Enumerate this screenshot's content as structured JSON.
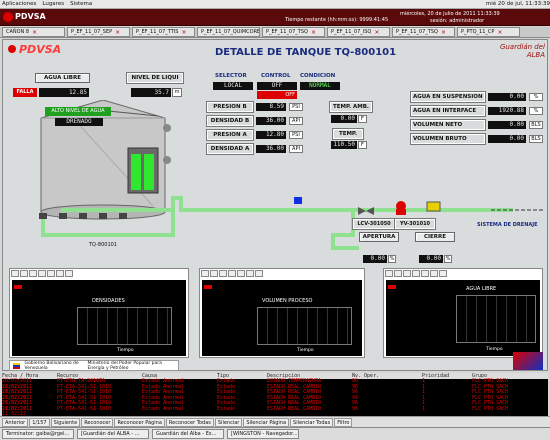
{
  "os_bar": {
    "apps": "Aplicaciones",
    "places": "Lugares",
    "system": "Sistema",
    "clock": "mié 20 de jul, 11:33:39"
  },
  "app_header": {
    "brand": "PDVSA",
    "info1": "Tiempo restante (hh:mm:ss): 9999:41:45",
    "info2": "miércoles, 20 de julio de 2011 11:33:39",
    "info3": "sesión: administrador"
  },
  "tabs": [
    {
      "label": "CAÑON 8"
    },
    {
      "label": "P_EF_11_07_SEP"
    },
    {
      "label": "P_EF_11_07_TTIS"
    },
    {
      "label": "P_EF_11_07_QUIMCORE"
    },
    {
      "label": "P_EF_11_07_TSQ"
    },
    {
      "label": "P_EF_11_07_ISQ"
    },
    {
      "label": "P_EF_11_07_TSQ"
    },
    {
      "label": "P_PTQ_11_CP"
    }
  ],
  "page": {
    "brand": "PDVSA",
    "title": "DETALLE DE TANQUE TQ-800101",
    "right_logo": "Guardián del ALBA"
  },
  "controls": {
    "agua_libre_label": "AGUA LIBRE",
    "agua_libre_status": "FALLA",
    "agua_libre_val": "12.85",
    "nivel_label": "NIVEL DE LIQUI",
    "nivel_val": "35.7",
    "nivel_unit": "m",
    "selector_label": "SELECTOR",
    "selector_val": "LOCAL",
    "control_label": "CONTROL",
    "control_val": "OFF",
    "condicion_label": "CONDICION",
    "condicion_val": "NORMAL",
    "off2": "OFF"
  },
  "tank": {
    "alarm_label": "ALTO NIVEL DE AGUA",
    "alarm_state": "DRENADO",
    "name": "TQ-800101"
  },
  "readings": [
    {
      "label": "PRESION B",
      "value": "8.59",
      "unit": "PSI"
    },
    {
      "label": "DENSIDAD B",
      "value": "36.00",
      "unit": "API"
    },
    {
      "label": "PRESION A",
      "value": "12.80",
      "unit": "PSI"
    },
    {
      "label": "DENSIDAD A",
      "value": "36.00",
      "unit": "API"
    }
  ],
  "temp": {
    "amb_label": "TEMP. AMB.",
    "amb_value": "0.00",
    "amb_unit": "F",
    "temp_label": "TEMP.",
    "temp_value": "110.50",
    "temp_unit": "F"
  },
  "volumes": [
    {
      "label": "AGUA EN SUSPENSION",
      "value": "0.00",
      "unit": "%"
    },
    {
      "label": "AGUA EN INTERFACE",
      "value": "1920.88",
      "unit": "%"
    },
    {
      "label": "VOLUMEN NETO",
      "value": "0.00",
      "unit": "BLS"
    },
    {
      "label": "VOLUMEN BRUTO",
      "value": "0.00",
      "unit": "BLS"
    }
  ],
  "valves": {
    "lcv": "LCV-301050",
    "yv": "YV-301010",
    "apertura": "APERTURA",
    "cierre": "CIERRE",
    "pct1": "0.00",
    "pct2": "0.00",
    "pct_unit": "%",
    "sistema": "SISTEMA DE DRENAJE"
  },
  "trends": [
    {
      "title": "DENSIDADES",
      "xlabel": "Tiempo"
    },
    {
      "title": "VOLUMEN PROCESO",
      "xlabel": "Tiempo"
    },
    {
      "title": "AGUA LIBRE",
      "xlabel": "Tiempo"
    }
  ],
  "footer_logo": {
    "left": "Gobierno Bolivariano de Venezuela",
    "right": "Ministerio del Poder Popular para Energía y Petróleo"
  },
  "alarms": {
    "headers": [
      "Fecha / Hora",
      "Recurso",
      "Causa",
      "Tipo",
      "Descripción",
      "Nv. Oper.",
      "Prioridad",
      "Grupo"
    ],
    "rows": [
      [
        "20/07/2011 11:32:27",
        "PT-ETA-TA-2010TA",
        "Estado Anormal",
        "Estado",
        "ESTADO TEMPERATURA",
        "96",
        "1",
        "FLC PTQ SACH"
      ],
      [
        "20/07/2011 11:32:27",
        "PT-ETA-541-51-1010",
        "Estado Anormal",
        "Estado",
        "ESTADO REAL CAMBIO",
        "96",
        "1",
        "FLC PTQ SACH"
      ],
      [
        "20/07/2011 11:32:27",
        "PT-ETA-541-51-1010",
        "Estado Anormal",
        "Estado",
        "ESTADO REAL CAMBIO",
        "96",
        "1",
        "FLC PTQ SACH"
      ],
      [
        "20/07/2011 11:32:27",
        "PT-ETA-541-51-1010",
        "Estado Anormal",
        "Estado",
        "ESTADO REAL CAMBIO",
        "96",
        "1",
        "FLC PTQ SACH"
      ],
      [
        "20/07/2011 11:32:27",
        "PT-ETA-541-51-1010",
        "Estado Anormal",
        "Estado",
        "ESTADO REAL CAMBIO",
        "96",
        "1",
        "FLC PTQ SACH"
      ],
      [
        "20/07/2011 11:32:27",
        "PT-ETA-541-51-1010",
        "Estado Anormal",
        "Estado",
        "ESTADO REAL CAMBIO",
        "96",
        "1",
        "FLC PTQ SACH"
      ]
    ]
  },
  "footer_bar": {
    "prev": "Anterior",
    "page": "1/157",
    "next": "Siguiente",
    "b1": "Reconocer",
    "b2": "Reconocer Página",
    "b3": "Reconocer Todas",
    "b4": "Silenciar",
    "b5": "Silenciar Página",
    "b6": "Silenciar Todas",
    "b7": "Filtro"
  },
  "taskbar": [
    {
      "label": "Terminator: gaiba@rgel..."
    },
    {
      "label": "[Guardián del ALBA - ..."
    },
    {
      "label": "Guardián del Alba - Es..."
    },
    {
      "label": "[WINGSTON - Navegador..."
    }
  ],
  "colors": {
    "pipe": "#8fe08f",
    "tank": "#c6c6c6",
    "red": "#d00000",
    "value_bg": "#101010",
    "title_blue": "#1a2a80"
  }
}
